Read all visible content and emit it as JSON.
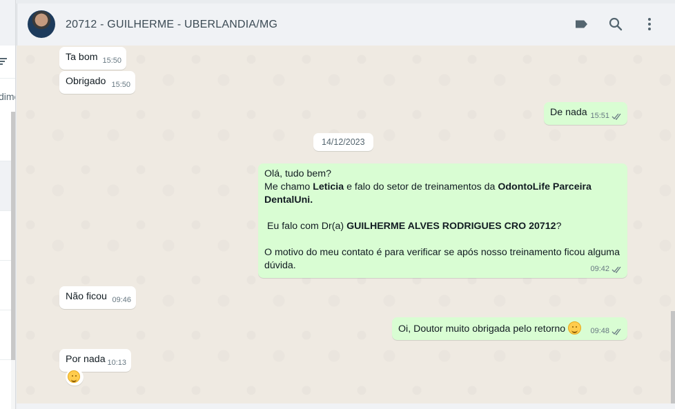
{
  "contact": {
    "name": "20712 - GUILHERME - UBERLANDIA/MG"
  },
  "icons": {
    "label": "label-icon",
    "search": "search-icon",
    "menu": "more-vert-icon"
  },
  "sidebar": {
    "tab_fragment": "dime"
  },
  "colors": {
    "incoming": "#ffffff",
    "outgoing": "#d9fdd3",
    "chat_bg": "#efeae2",
    "header_bg": "#f0f2f5",
    "tick": "#667781"
  },
  "messages": [
    {
      "dir": "in",
      "text": "Ta bom",
      "time": "15:50"
    },
    {
      "dir": "in",
      "text": "Obrigado",
      "time": "15:50"
    },
    {
      "dir": "out",
      "text": "De nada",
      "time": "15:51",
      "status": "read"
    },
    {
      "date": "14/12/2023"
    },
    {
      "dir": "out",
      "time": "09:42",
      "status": "read",
      "lines": [
        [
          "Olá, tudo bem?"
        ],
        [
          "Me chamo ",
          "Leticia",
          " e falo do setor de treinamentos  da ",
          "OdontoLife Parceira"
        ],
        [
          "DentalUni."
        ],
        [
          ""
        ],
        [
          " Eu falo com Dr(a) ",
          "GUILHERME ALVES RODRIGUES CRO 20712",
          "?"
        ],
        [
          ""
        ],
        [
          "O motivo do meu contato é para verificar se após nosso treinamento ficou alguma"
        ],
        [
          "dúvida."
        ]
      ]
    },
    {
      "dir": "in",
      "text": "Não ficou",
      "time": "09:46"
    },
    {
      "dir": "out",
      "text": "Oi, Doutor muito obrigada pelo retorno",
      "emoji": "relieved-face",
      "time": "09:48",
      "status": "read"
    },
    {
      "dir": "in",
      "text": "Por nada",
      "time": "10:13",
      "reaction": "smiling-face"
    }
  ]
}
